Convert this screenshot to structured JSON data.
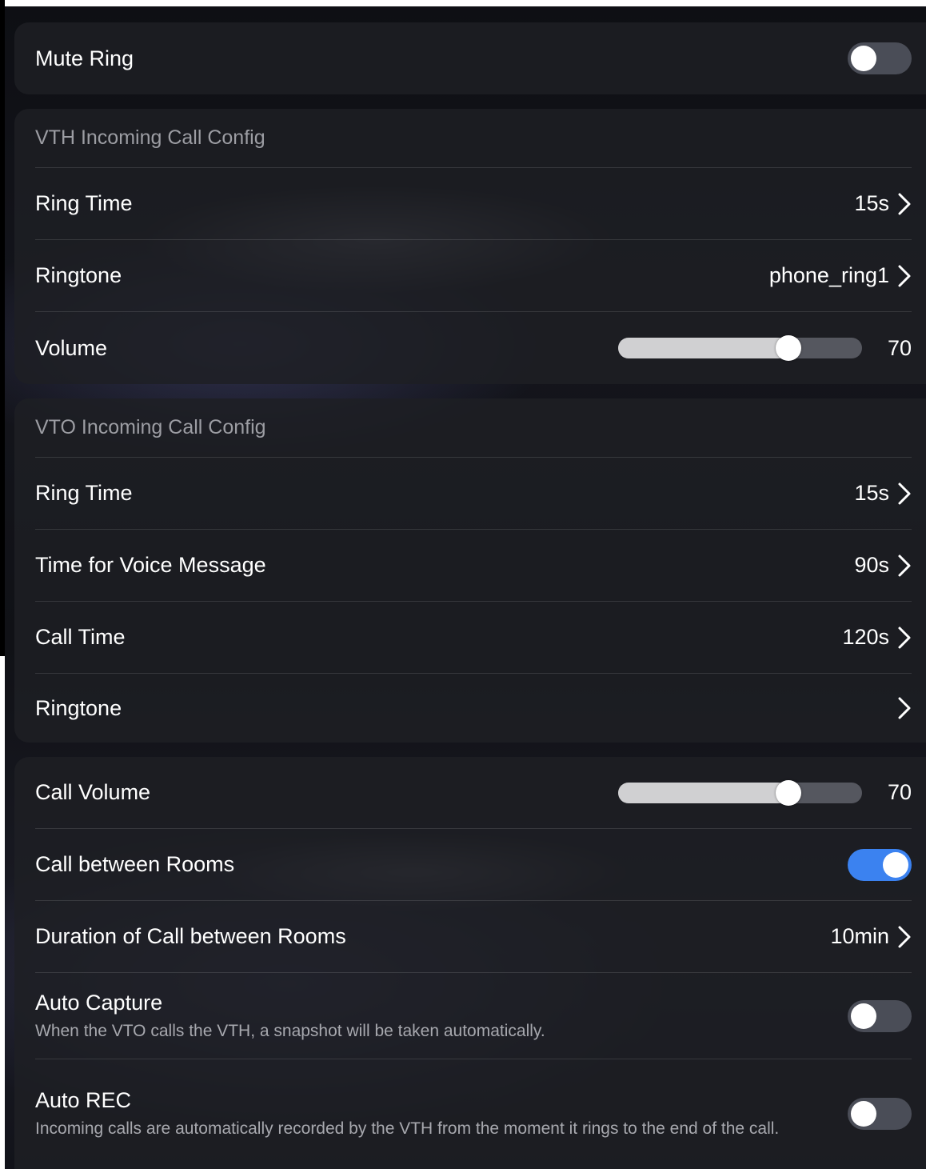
{
  "mute_ring": {
    "label": "Mute Ring",
    "toggle_on": false
  },
  "vth": {
    "header": "VTH Incoming Call Config",
    "ring_time": {
      "label": "Ring Time",
      "value": "15s"
    },
    "ringtone": {
      "label": "Ringtone",
      "value": "phone_ring1"
    },
    "volume": {
      "label": "Volume",
      "value": "70",
      "level": 70
    }
  },
  "vto": {
    "header": "VTO Incoming Call Config",
    "ring_time": {
      "label": "Ring Time",
      "value": "15s"
    },
    "voice_message": {
      "label": "Time for Voice Message",
      "value": "90s"
    },
    "call_time": {
      "label": "Call Time",
      "value": "120s"
    },
    "ringtone": {
      "label": "Ringtone"
    }
  },
  "call": {
    "volume": {
      "label": "Call Volume",
      "value": "70",
      "level": 70
    },
    "between_rooms": {
      "label": "Call between Rooms",
      "toggle_on": true
    },
    "duration": {
      "label": "Duration of Call between Rooms",
      "value": "10min"
    },
    "auto_capture": {
      "label": "Auto Capture",
      "description": "When the VTO calls the VTH, a snapshot will be taken automatically.",
      "toggle_on": false
    },
    "auto_rec": {
      "label": "Auto REC",
      "description": "Incoming calls are automatically recorded by the VTH from the moment it rings to the end of the call.",
      "toggle_on": false
    }
  },
  "colors": {
    "accent": "#3b82f0",
    "card": "#1e1f24",
    "toggle_off": "#4a4d57"
  }
}
